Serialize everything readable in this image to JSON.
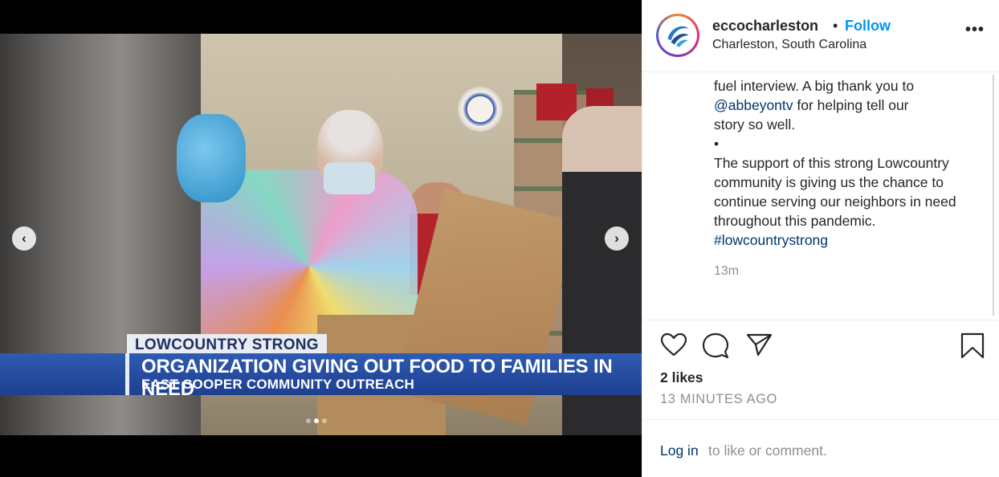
{
  "post": {
    "username": "eccocharleston",
    "separator": "•",
    "follow_label": "Follow",
    "location": "Charleston, South Carolina",
    "more_label": "•••"
  },
  "media": {
    "chyron_top": "LOWCOUNTRY STRONG",
    "chyron_headline": "ORGANIZATION GIVING OUT FOOD TO FAMILIES IN NEED",
    "chyron_subline": "EAST COOPER COMMUNITY OUTREACH",
    "prev_icon": "‹",
    "next_icon": "›",
    "carousel_dots": 3,
    "active_dot": 2
  },
  "caption": {
    "line1": "fuel interview. A big thank you to",
    "mention": "@abbeyontv",
    "line2_rest": " for helping tell our",
    "line3": "story so well.",
    "bullet": "•",
    "body": "The support of this strong Lowcountry community is giving us the chance to continue serving our neighbors in need throughout this pandemic. ",
    "hashtag": "#lowcountrystrong",
    "relative_time": "13m"
  },
  "actions": {
    "like_icon": "heart-icon",
    "comment_icon": "comment-icon",
    "share_icon": "share-icon",
    "save_icon": "bookmark-icon"
  },
  "stats": {
    "likes": "2 likes",
    "timestamp": "13 MINUTES AGO"
  },
  "footer": {
    "login_link": "Log in",
    "login_rest": "to like or comment."
  },
  "colors": {
    "link_blue": "#0095f6",
    "dark_link": "#00376b",
    "muted": "#8e8e8e",
    "chyron_blue": "#1d3f8f"
  }
}
